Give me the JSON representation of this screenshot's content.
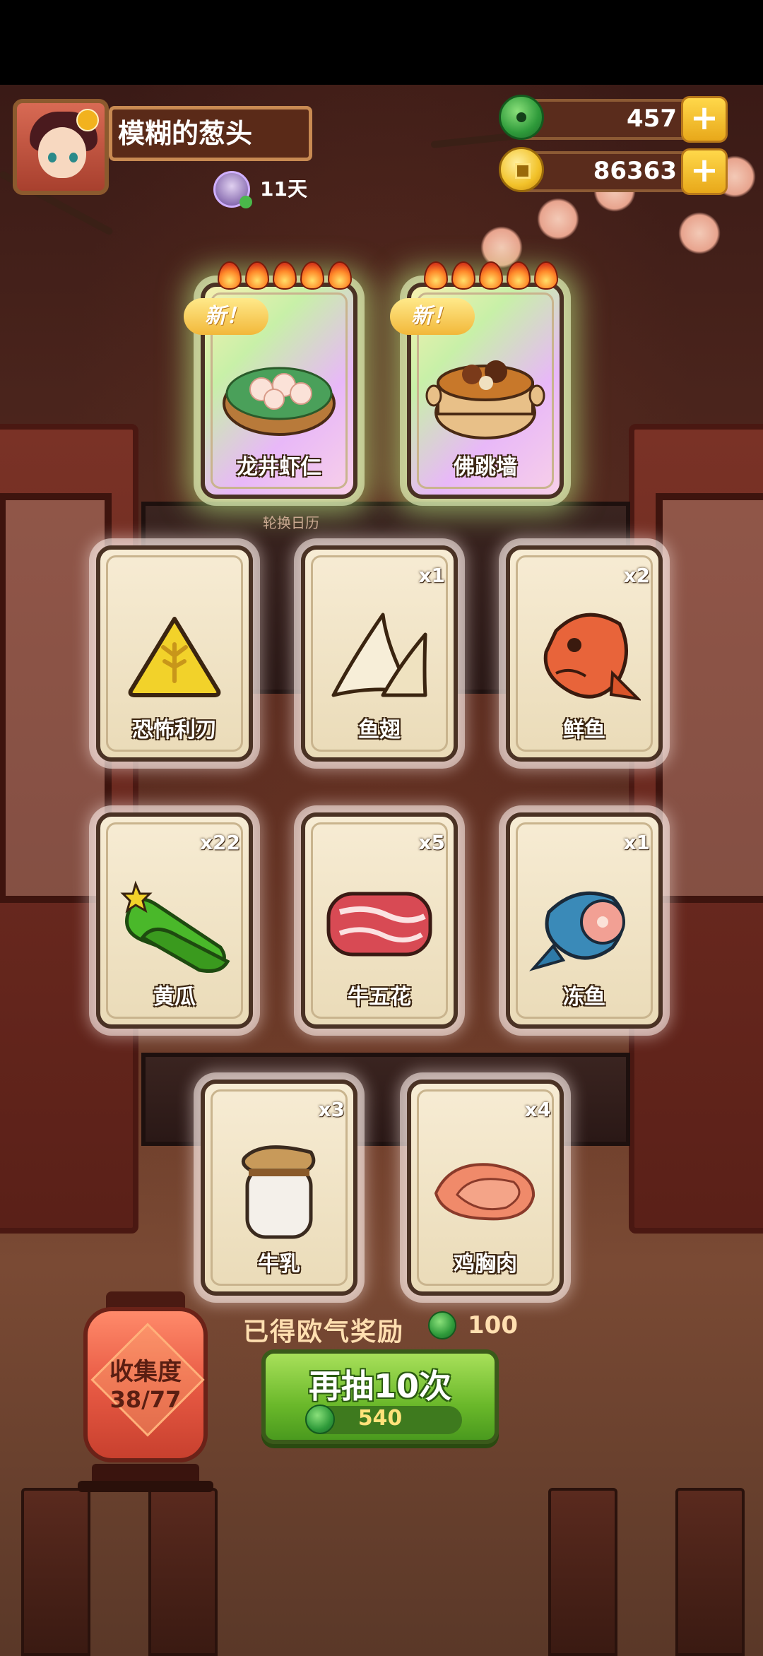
{
  "player": {
    "name": "模糊的葱头",
    "days": "11天"
  },
  "currencies": {
    "jade": "457",
    "coins": "86363",
    "plus": "+"
  },
  "new_badge": "新！",
  "featured": [
    {
      "name": "龙井虾仁"
    },
    {
      "name": "佛跳墙"
    }
  ],
  "calendar_label": "轮换日历",
  "cards": [
    {
      "name": "恐怖利刃",
      "count": ""
    },
    {
      "name": "鱼翅",
      "count": "x1"
    },
    {
      "name": "鲜鱼",
      "count": "x2"
    },
    {
      "name": "黄瓜",
      "count": "x22"
    },
    {
      "name": "牛五花",
      "count": "x5"
    },
    {
      "name": "冻鱼",
      "count": "x1"
    },
    {
      "name": "牛乳",
      "count": "x3"
    },
    {
      "name": "鸡胸肉",
      "count": "x4"
    }
  ],
  "collection": {
    "label": "收集度",
    "progress": "38/77"
  },
  "reward": {
    "label": "已得欧气奖励",
    "value": "100"
  },
  "draw_button": {
    "label": "再抽10次",
    "cost": "540"
  },
  "colors": {
    "accent_green": "#6ab82a",
    "gold": "#f2c22a",
    "card_border": "#4a3224"
  }
}
